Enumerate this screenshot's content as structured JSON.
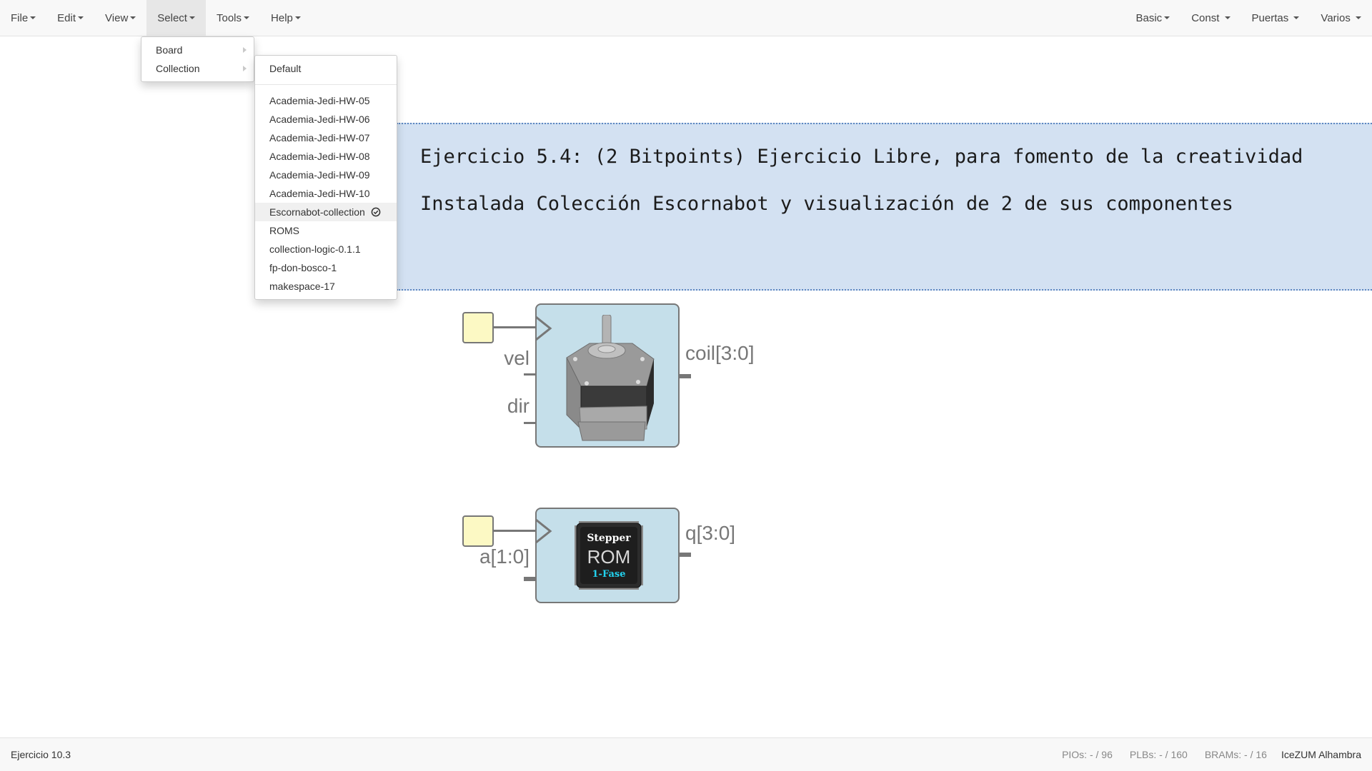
{
  "menubar": {
    "left": [
      {
        "label": "File"
      },
      {
        "label": "Edit"
      },
      {
        "label": "View"
      },
      {
        "label": "Select"
      },
      {
        "label": "Tools"
      },
      {
        "label": "Help"
      }
    ],
    "right": [
      {
        "label": "Basic"
      },
      {
        "label": "Const"
      },
      {
        "label": "Puertas"
      },
      {
        "label": "Varios"
      }
    ]
  },
  "select_menu": {
    "items": [
      {
        "label": "Board"
      },
      {
        "label": "Collection"
      }
    ]
  },
  "collection_menu": {
    "default_label": "Default",
    "items": [
      {
        "label": "Academia-Jedi-HW-05"
      },
      {
        "label": "Academia-Jedi-HW-06"
      },
      {
        "label": "Academia-Jedi-HW-07"
      },
      {
        "label": "Academia-Jedi-HW-08"
      },
      {
        "label": "Academia-Jedi-HW-09"
      },
      {
        "label": "Academia-Jedi-HW-10"
      },
      {
        "label": "Escornabot-collection",
        "selected": true,
        "icon": "check-circle-icon"
      },
      {
        "label": "ROMS"
      },
      {
        "label": "collection-logic-0.1.1"
      },
      {
        "label": "fp-don-bosco-1"
      },
      {
        "label": "makespace-17"
      }
    ]
  },
  "info": {
    "line1": "Ejercicio 5.4: (2 Bitpoints) Ejercicio Libre, para fomento de la creatividad",
    "line2": "Instalada Colección Escornabot y visualización de 2 de sus componentes"
  },
  "blocks": {
    "motor": {
      "inputs": [
        "vel",
        "dir"
      ],
      "output": "coil[3:0]",
      "icon": "stepper-motor-icon"
    },
    "rom": {
      "input": "a[1:0]",
      "output": "q[3:0]",
      "chip_line1": "Stepper",
      "chip_line2": "ROM",
      "chip_line3": "1-Fase"
    }
  },
  "footer": {
    "project": "Ejercicio 10.3",
    "pios": "PIOs: - / 96",
    "plbs": "PLBs: - / 160",
    "brams": "BRAMs: - / 16",
    "board": "IceZUM Alhambra"
  },
  "colors": {
    "menubar_bg": "#f8f8f8",
    "info_bg": "#d3e1f2",
    "info_border": "#5d87c1",
    "block_bg": "#c5dfea",
    "pin_bg": "#fcf9c4",
    "chip_accent": "#22d3f0"
  }
}
